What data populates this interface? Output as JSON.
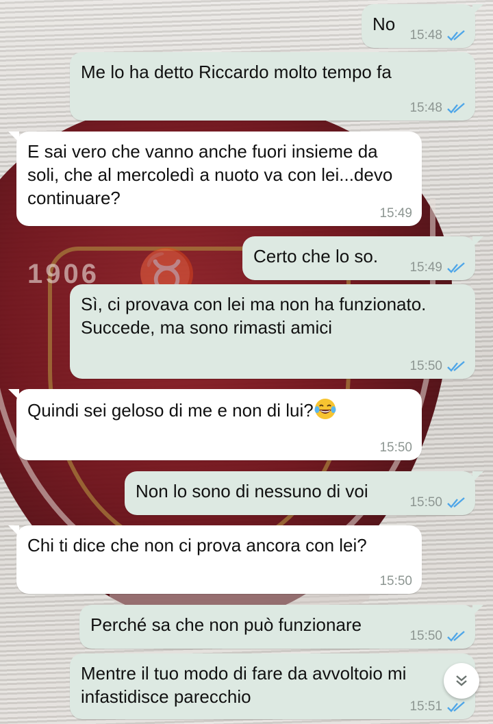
{
  "chat": {
    "messages": [
      {
        "direction": "out",
        "text": "No",
        "time": "15:48",
        "status": "read"
      },
      {
        "direction": "out",
        "text": "Me lo ha detto Riccardo molto tempo fa",
        "time": "15:48",
        "status": "read"
      },
      {
        "direction": "in",
        "text": "E sai vero che vanno anche fuori insieme da soli, che al mercoledì a nuoto va con lei...devo continuare?",
        "time": "15:49"
      },
      {
        "direction": "out",
        "text": "Certo che lo so.",
        "time": "15:49",
        "status": "read"
      },
      {
        "direction": "out",
        "text": "Sì, ci provava con lei ma non ha funzionato. Succede, ma sono rimasti amici",
        "time": "15:50",
        "status": "read"
      },
      {
        "direction": "in",
        "text": "Quindi sei geloso di me e non di lui?",
        "emoji": "rolling-on-floor-laughing",
        "time": "15:50"
      },
      {
        "direction": "out",
        "text": "Non lo sono di nessuno di voi",
        "time": "15:50",
        "status": "read"
      },
      {
        "direction": "in",
        "text": "Chi ti dice che non ci prova ancora con lei?",
        "time": "15:50"
      },
      {
        "direction": "out",
        "text": "Perché sa che non può funzionare",
        "time": "15:50",
        "status": "read"
      },
      {
        "direction": "out",
        "text": "Mentre il tuo modo di fare da avvoltoio mi infastidisce parecchio",
        "time": "15:51",
        "status": "read"
      }
    ]
  },
  "wallpaper": {
    "year": "1906"
  },
  "colors": {
    "outgoing_bubble": "#dde9e2",
    "incoming_bubble": "#ffffff",
    "read_ticks": "#4fa6e8",
    "timestamp": "#8d9692",
    "wallpaper_crest": "#6d1018"
  },
  "icons": {
    "read_receipt": "double-check-icon",
    "scroll_down": "double-chevron-down-icon"
  }
}
